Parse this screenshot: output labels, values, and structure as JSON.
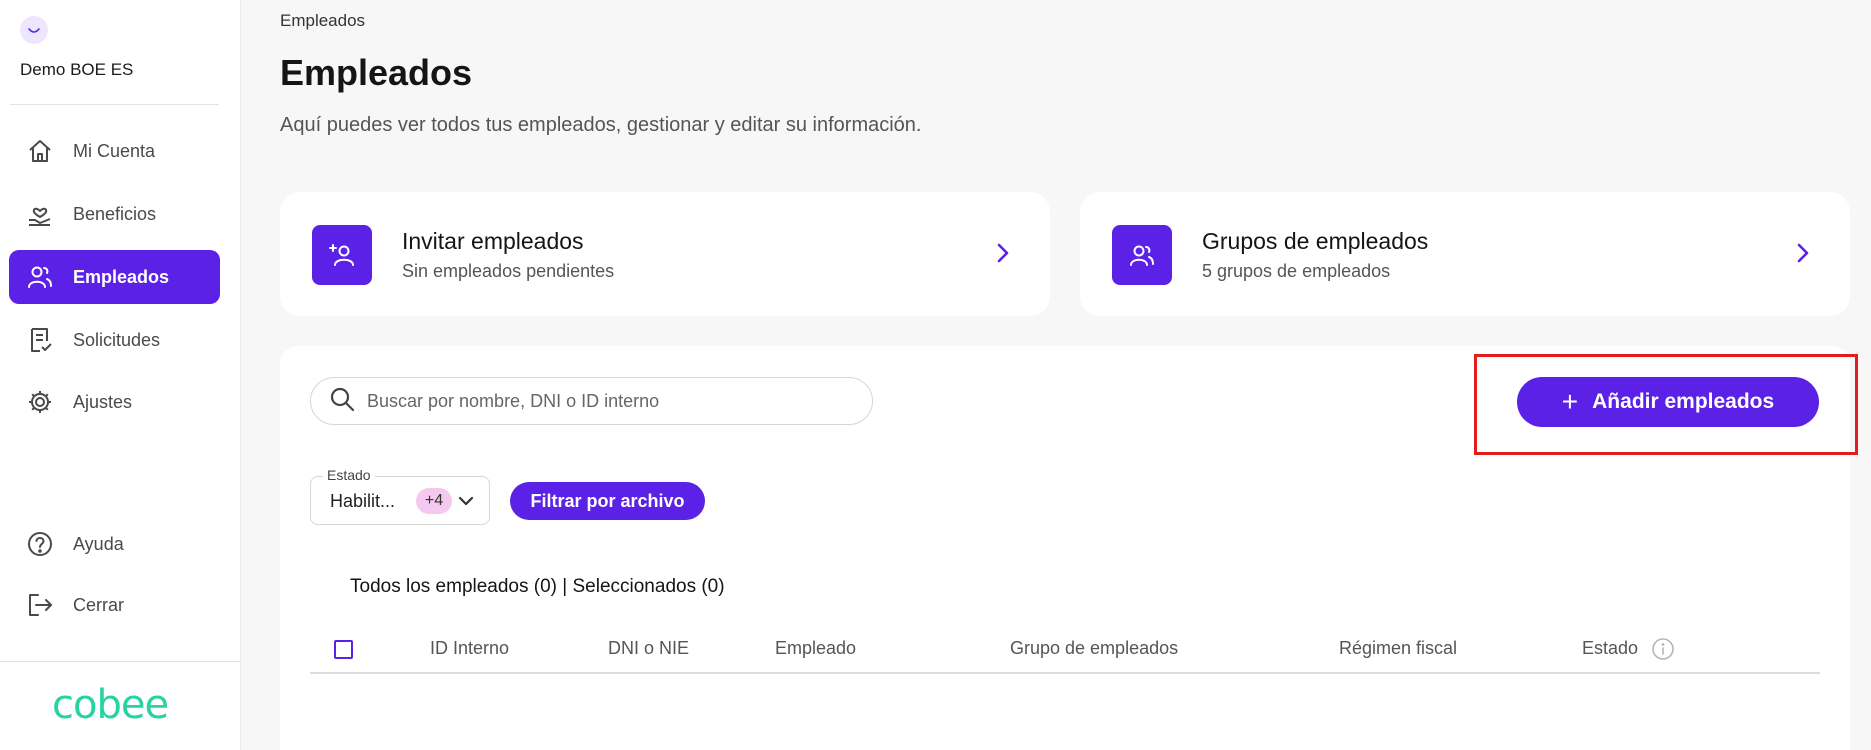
{
  "sidebar": {
    "company_name": "Demo BOE ES",
    "nav": [
      {
        "label": "Mi Cuenta",
        "icon": "home-icon"
      },
      {
        "label": "Beneficios",
        "icon": "benefits-icon"
      },
      {
        "label": "Empleados",
        "icon": "users-icon",
        "active": true
      },
      {
        "label": "Solicitudes",
        "icon": "requests-icon"
      },
      {
        "label": "Ajustes",
        "icon": "gear-icon"
      }
    ],
    "bottom_nav": [
      {
        "label": "Ayuda",
        "icon": "help-icon"
      },
      {
        "label": "Cerrar",
        "icon": "logout-icon"
      }
    ],
    "brand": "cobee"
  },
  "header": {
    "breadcrumb": "Empleados",
    "title": "Empleados",
    "description": "Aquí puedes ver todos tus empleados, gestionar y editar su información."
  },
  "cards": [
    {
      "title": "Invitar empleados",
      "subtitle": "Sin empleados pendientes",
      "icon": "add-user-icon"
    },
    {
      "title": "Grupos de empleados",
      "subtitle": "5 grupos de empleados",
      "icon": "group-icon"
    }
  ],
  "search": {
    "placeholder": "Buscar por nombre, DNI o ID interno"
  },
  "add_button_label": "Añadir empleados",
  "status_filter": {
    "legend": "Estado",
    "value": "Habilit...",
    "extra_count": "+4"
  },
  "filter_file_label": "Filtrar por archivo",
  "counts_text": "Todos los empleados (0) | Seleccionados (0)",
  "table": {
    "columns": [
      "ID Interno",
      "DNI o NIE",
      "Empleado",
      "Grupo de empleados",
      "Régimen fiscal",
      "Estado"
    ]
  },
  "colors": {
    "accent": "#5b21e6",
    "brand": "#27d3a0",
    "highlight": "#e11d1d",
    "badge": "#f5c8f0"
  }
}
